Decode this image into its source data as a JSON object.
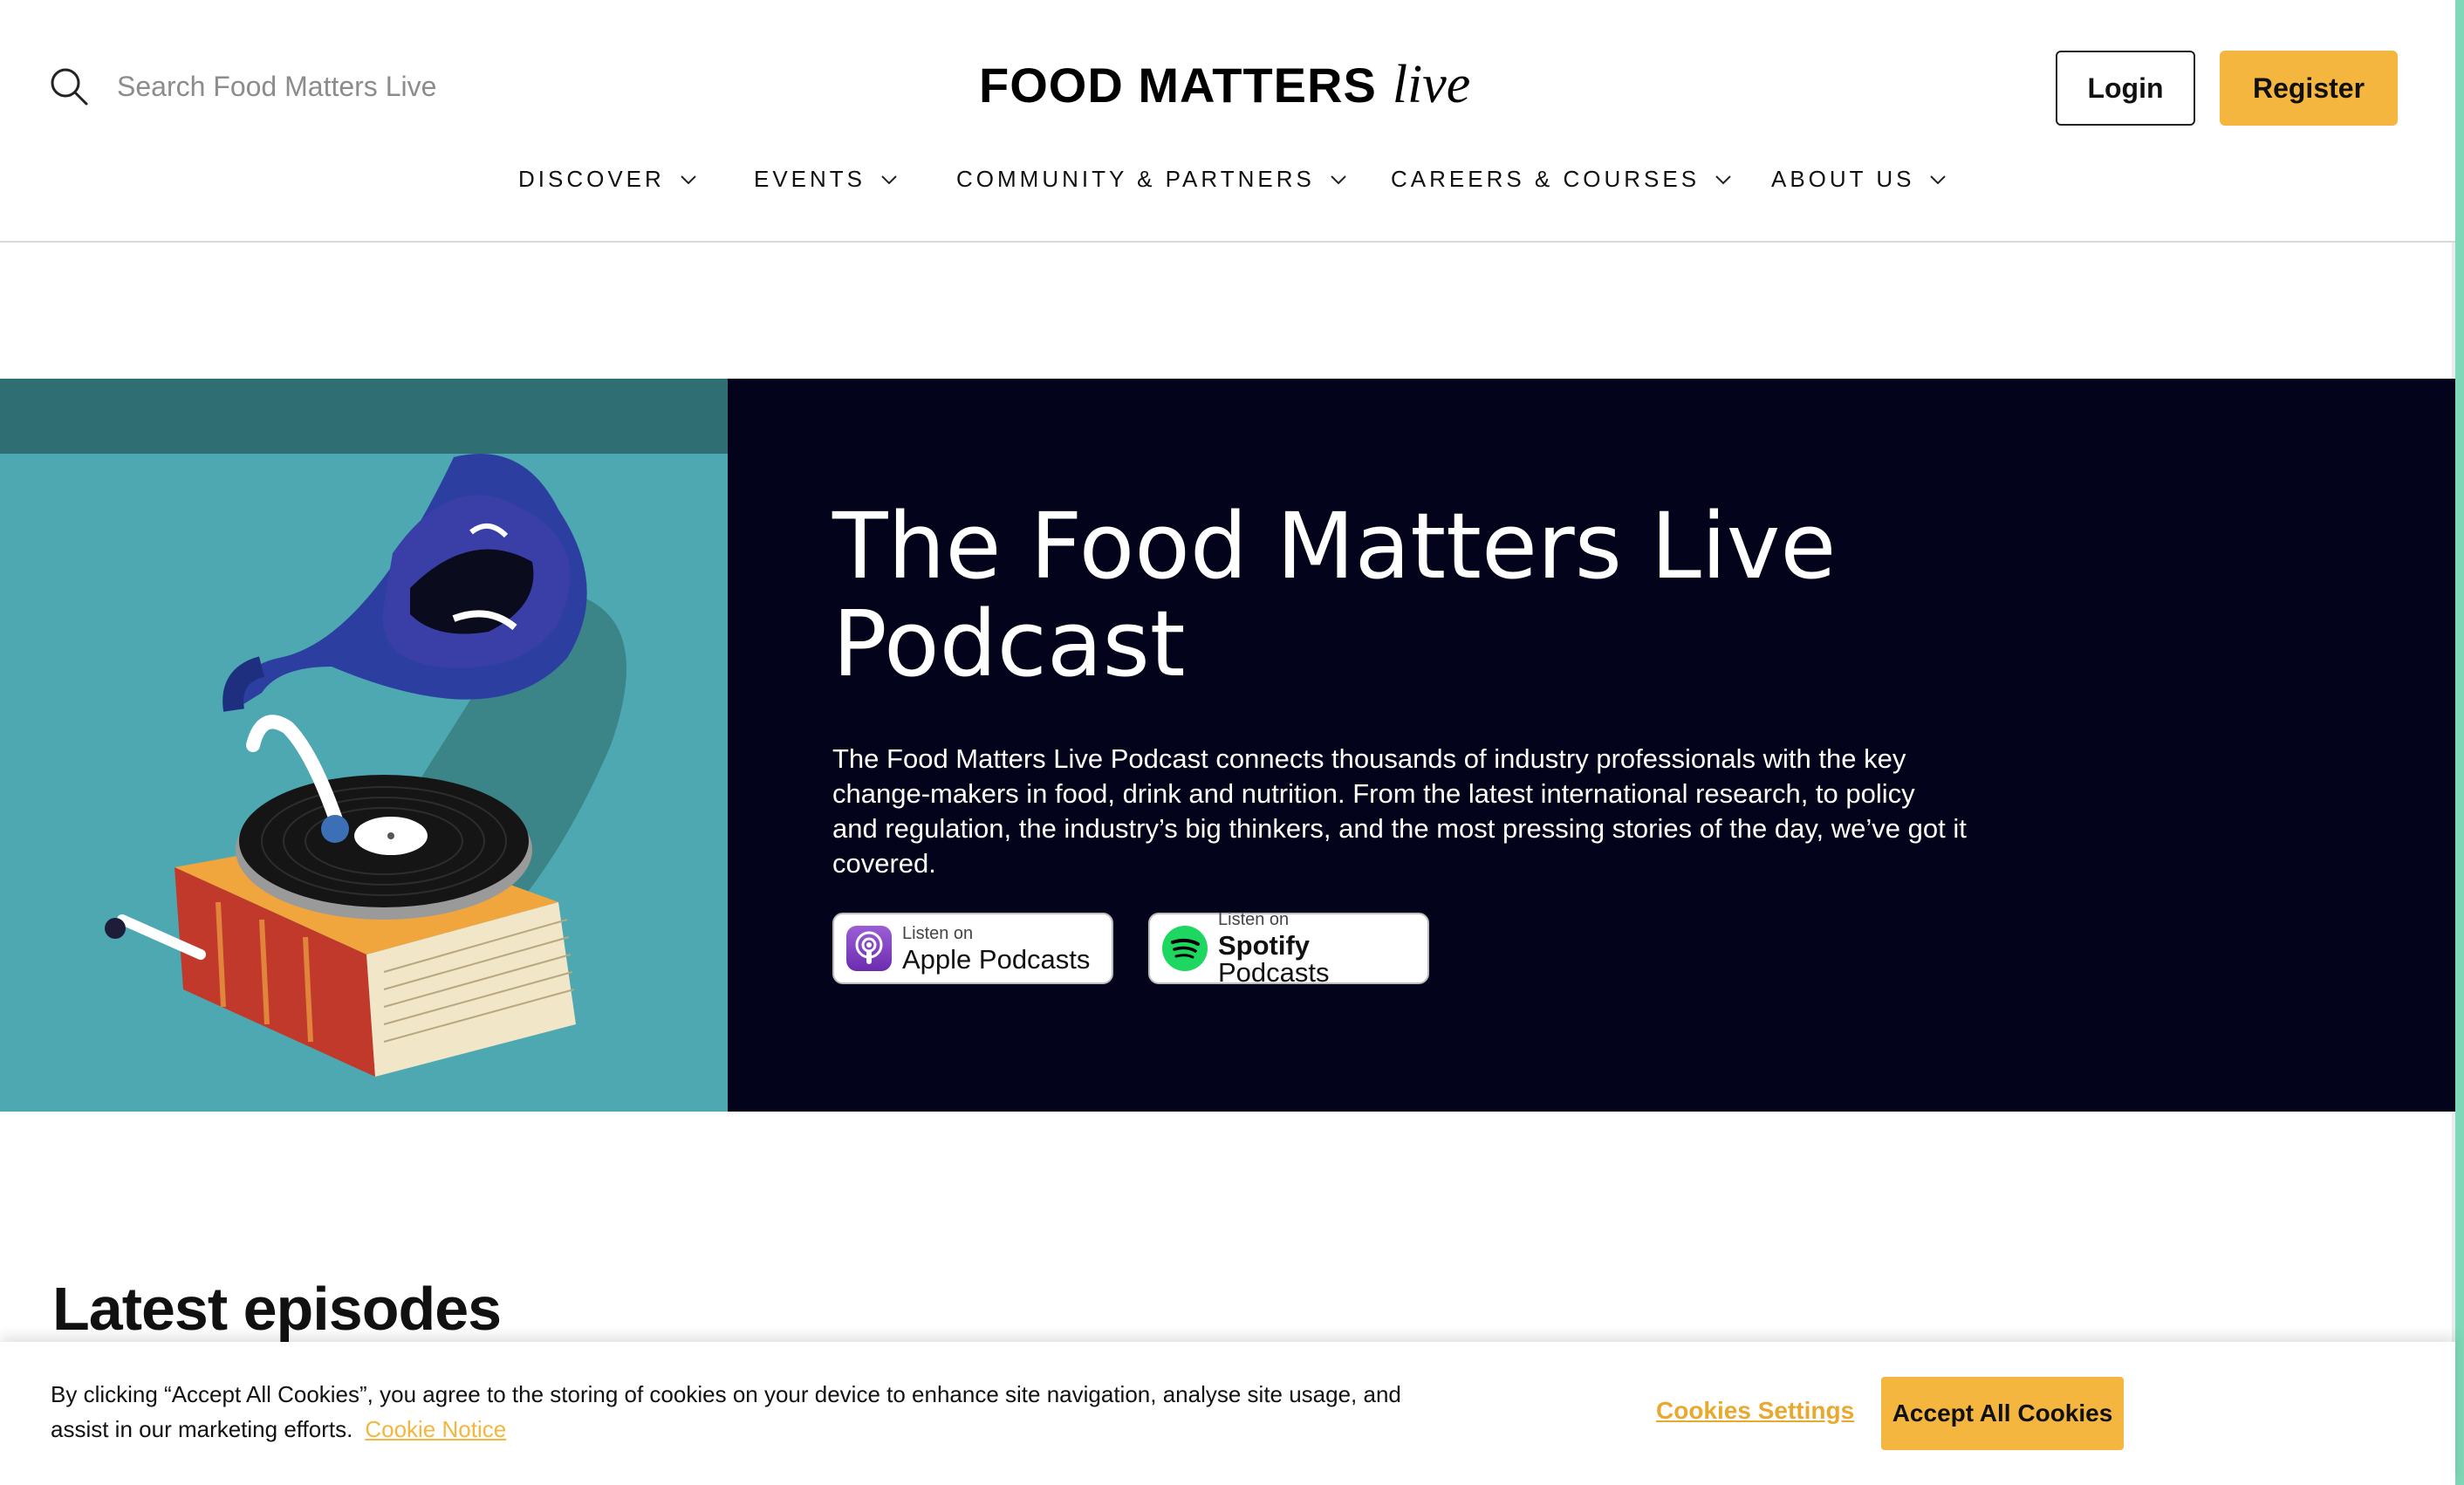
{
  "header": {
    "search_placeholder": "Search Food Matters Live",
    "logo_main": "FOOD MATTERS",
    "logo_live": "live",
    "login_label": "Login",
    "register_label": "Register"
  },
  "nav": {
    "items": [
      {
        "label": "DISCOVER"
      },
      {
        "label": "EVENTS"
      },
      {
        "label": "COMMUNITY & PARTNERS"
      },
      {
        "label": "CAREERS & COURSES"
      },
      {
        "label": "ABOUT US"
      }
    ]
  },
  "hero": {
    "title": "The Food Matters Live Podcast",
    "description": "The Food Matters Live Podcast connects thousands of industry professionals with the key change-makers in food, drink and nutrition. From the latest international research, to policy and regulation, the industry’s big thinkers, and the most pressing stories of the day, we’ve got it covered.",
    "apple_small": "Listen on",
    "apple_big": "Apple Podcasts",
    "spotify_small": "Listen on",
    "spotify_brand": "Spotify",
    "spotify_rest": "Podcasts"
  },
  "latest": {
    "heading": "Latest episodes"
  },
  "cookie": {
    "text": "By clicking “Accept All Cookies”, you agree to the storing of cookies on your device to enhance site navigation, analyse site usage, and assist in our marketing efforts.",
    "notice_link": "Cookie Notice",
    "settings_label": "Cookies Settings",
    "accept_label": "Accept All Cookies"
  },
  "colors": {
    "accent": "#f4b63f",
    "hero_dark": "#03031c",
    "hero_teal": "#4ea8b1"
  }
}
